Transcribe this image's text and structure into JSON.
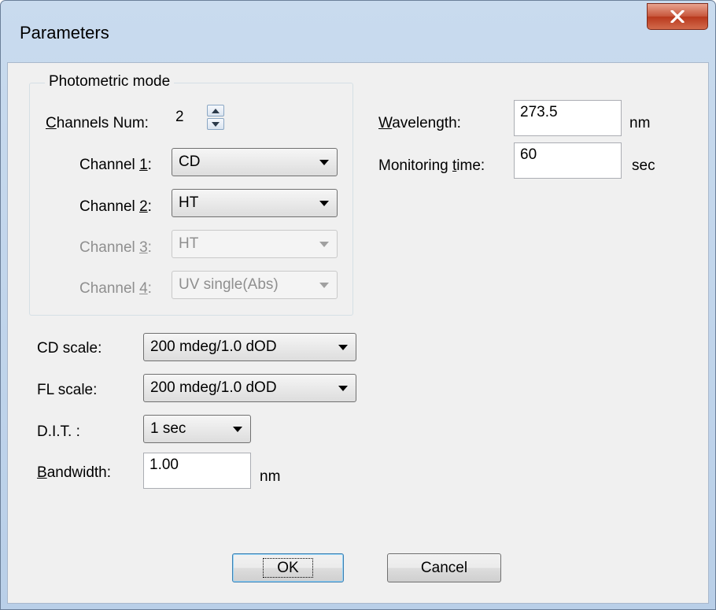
{
  "window": {
    "title": "Parameters"
  },
  "photometric": {
    "group_title": "Photometric mode",
    "channels_num": {
      "label_u": "C",
      "label_rest": "hannels Num:",
      "value": "2"
    },
    "channels": [
      {
        "label_pre": "Channel ",
        "label_u": "1",
        "label_post": ":",
        "value": "CD",
        "enabled": true
      },
      {
        "label_pre": "Channel ",
        "label_u": "2",
        "label_post": ":",
        "value": "HT",
        "enabled": true
      },
      {
        "label_pre": "Channel ",
        "label_u": "3",
        "label_post": ":",
        "value": "HT",
        "enabled": false
      },
      {
        "label_pre": "Channel ",
        "label_u": "4",
        "label_post": ":",
        "value": "UV single(Abs)",
        "enabled": false
      }
    ]
  },
  "scales": {
    "cd_label": "CD scale:",
    "cd_value": "200 mdeg/1.0 dOD",
    "fl_label": "FL scale:",
    "fl_value": "200 mdeg/1.0 dOD",
    "dit_label": "D.I.T. :",
    "dit_value": "1 sec",
    "bandwidth_label_u": "B",
    "bandwidth_label_rest": "andwidth:",
    "bandwidth_value": "1.00",
    "bandwidth_unit": "nm"
  },
  "right": {
    "wavelength_label_u": "W",
    "wavelength_label_rest": "avelength:",
    "wavelength_value": "273.5",
    "wavelength_unit": "nm",
    "monitoring_label_pre": "Monitoring ",
    "monitoring_label_u": "t",
    "monitoring_label_rest": "ime:",
    "monitoring_value": "60",
    "monitoring_unit": "sec"
  },
  "buttons": {
    "ok": "OK",
    "cancel": "Cancel"
  },
  "icons": {
    "close": "close-icon",
    "dropdown": "chevron-down-icon",
    "spin_up": "arrow-up-icon",
    "spin_down": "arrow-down-icon"
  }
}
